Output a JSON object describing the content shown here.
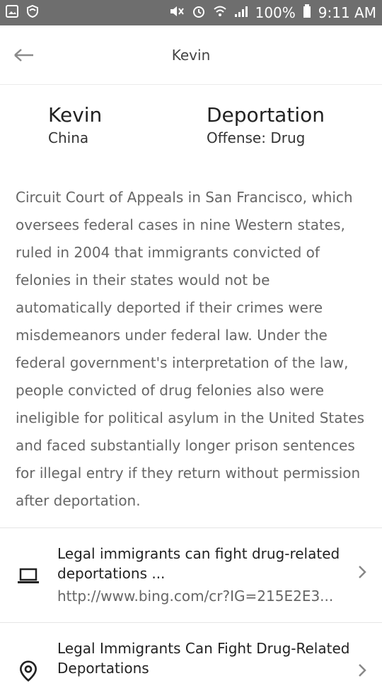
{
  "status_bar": {
    "battery": "100%",
    "time": "9:11 AM"
  },
  "app_bar": {
    "title": "Kevin"
  },
  "profile": {
    "name": "Kevin",
    "country": "China",
    "case_type": "Deportation",
    "offense": "Offense: Drug"
  },
  "article_text": "Circuit Court of Appeals in San Francisco, which oversees federal cases in nine Western states, ruled in 2004 that immigrants convicted of felonies in their states would not be automatically deported if their crimes were misdemeanors under federal law. Under the federal government's interpretation of the law, people convicted of drug felonies also were ineligible for political asylum in the United States and faced substantially longer prison sentences for illegal entry if they return without permission after deportation.",
  "links": [
    {
      "icon": "laptop-icon",
      "title": "Legal immigrants can fight drug-related deportations ...",
      "url": "http://www.bing.com/cr?IG=215E2E3..."
    },
    {
      "icon": "location-pin-icon",
      "title": "Legal Immigrants Can Fight Drug-Related Deportations"
    }
  ]
}
